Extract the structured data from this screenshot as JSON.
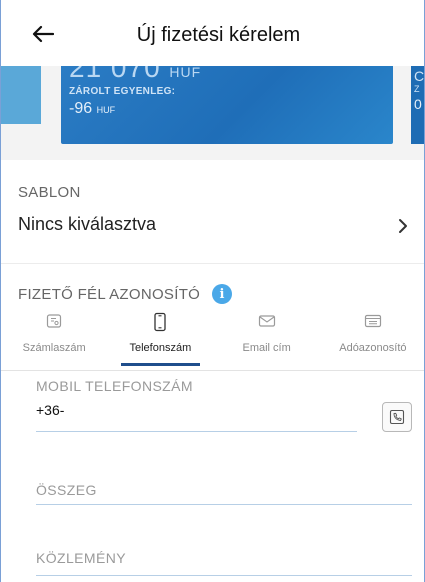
{
  "header": {
    "title": "Új fizetési kérelem"
  },
  "card": {
    "amount_partial": "21 070",
    "amount_currency": "HUF",
    "locked_label": "ZÁROLT EGYENLEG:",
    "locked_value": "-96",
    "locked_currency": "HUF",
    "next_card_peek": [
      "C",
      "Z",
      "0"
    ],
    "color": "#2277bf"
  },
  "template": {
    "label": "SABLON",
    "value": "Nincs kiválasztva"
  },
  "payer": {
    "label": "FIZETŐ FÉL AZONOSÍTÓ",
    "info_icon": "info-icon",
    "tabs": [
      {
        "label": "Számlaszám",
        "icon": "bank-card-icon",
        "active": false
      },
      {
        "label": "Telefonszám",
        "icon": "phone-icon",
        "active": true
      },
      {
        "label": "Email cím",
        "icon": "envelope-icon",
        "active": false
      },
      {
        "label": "Adóazonosító",
        "icon": "id-card-icon",
        "active": false
      }
    ]
  },
  "form": {
    "mobile_label": "MOBIL TELEFONSZÁM",
    "mobile_value": "+36-",
    "amount_label": "ÖSSZEG",
    "note_label": "KÖZLEMÉNY"
  },
  "colors": {
    "accent": "#1f4e8c",
    "info": "#4aa8e8",
    "field_underline": "#b7cfe6"
  }
}
